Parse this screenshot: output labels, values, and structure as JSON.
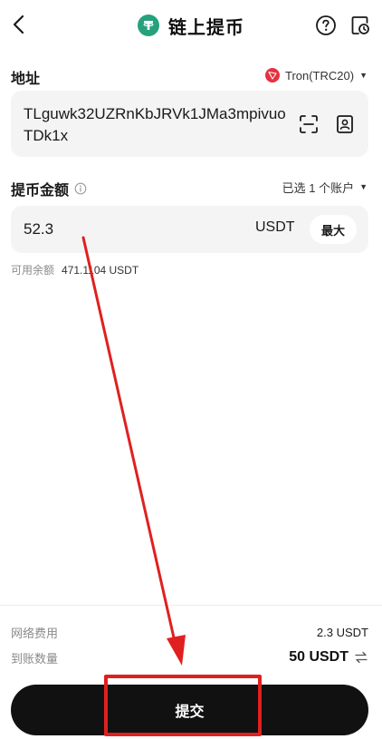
{
  "header": {
    "title": "链上提币",
    "back_icon": "chevron-left-icon",
    "help_icon": "question-circle-icon",
    "history_icon": "history-document-icon"
  },
  "address_section": {
    "label": "地址",
    "network": "Tron(TRC20)",
    "address_value": "TLguwk32UZRnKbJRVk1JMa3mpivuoTDk1x"
  },
  "amount_section": {
    "label": "提币金额",
    "account_select": "已选 1 个账户",
    "amount_value": "52.3",
    "unit": "USDT",
    "max_label": "最大",
    "available_label": "可用余额",
    "available_value": "471.1104 USDT"
  },
  "summary": {
    "fee_label": "网络费用",
    "fee_value": "2.3 USDT",
    "receive_label": "到账数量",
    "receive_value": "50 USDT"
  },
  "submit": {
    "label": "提交"
  },
  "colors": {
    "tether_green": "#26a17b",
    "tron_red": "#e8303f",
    "annotation_red": "#e02020",
    "button_black": "#111111"
  }
}
